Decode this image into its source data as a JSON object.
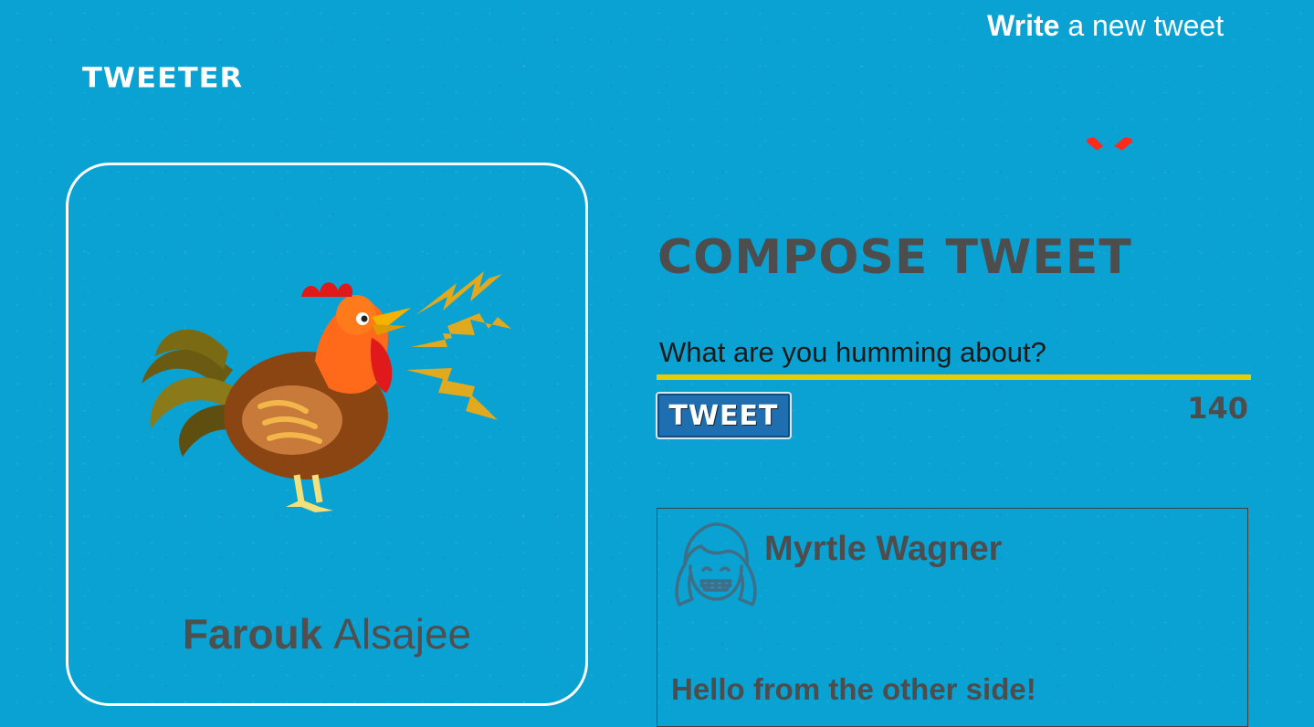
{
  "header": {
    "brand": "TWEETER",
    "write_bold": "Write",
    "write_rest": "a new tweet",
    "toggle_icon": "chevron-down-icon",
    "toggle_color": "#ff2a1a"
  },
  "profile": {
    "first_name": "Farouk",
    "last_name": "Alsajee",
    "image_icon": "rooster-icon"
  },
  "compose": {
    "title": "COMPOSE TWEET",
    "placeholder": "What are you humming about?",
    "tweet_button": "TWEET",
    "counter": "140",
    "underline_color": "#e6cc00"
  },
  "tweets": [
    {
      "author": "Myrtle Wagner",
      "text": "Hello from the other side!",
      "avatar_icon": "girl-avatar-icon"
    }
  ],
  "colors": {
    "background": "#0aa1d3",
    "text_dark": "#4d4d4d",
    "button": "#1f6fb0"
  }
}
